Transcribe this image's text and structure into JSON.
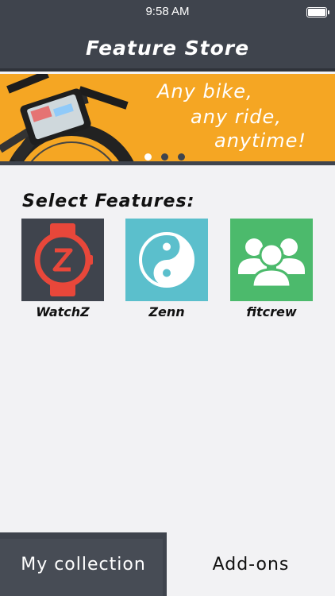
{
  "status_bar": {
    "time": "9:58 AM"
  },
  "header": {
    "title": "Feature Store"
  },
  "banner": {
    "lines": [
      "Any bike,",
      "any ride,",
      "anytime!"
    ],
    "page_count": 3,
    "active_page": 1
  },
  "features": {
    "heading": "Select Features:",
    "items": [
      {
        "name": "WatchZ",
        "icon": "watch-z-icon",
        "color": "#3f444d"
      },
      {
        "name": "Zenn",
        "icon": "yin-yang-icon",
        "color": "#5bbfcc"
      },
      {
        "name": "fitcrew",
        "icon": "group-icon",
        "color": "#4cba6c"
      }
    ]
  },
  "tabs": {
    "collection": "My collection",
    "addons": "Add-ons",
    "active": "addons"
  },
  "colors": {
    "dark": "#3f444d",
    "banner": "#f5a623",
    "watch_red": "#e8473a"
  }
}
